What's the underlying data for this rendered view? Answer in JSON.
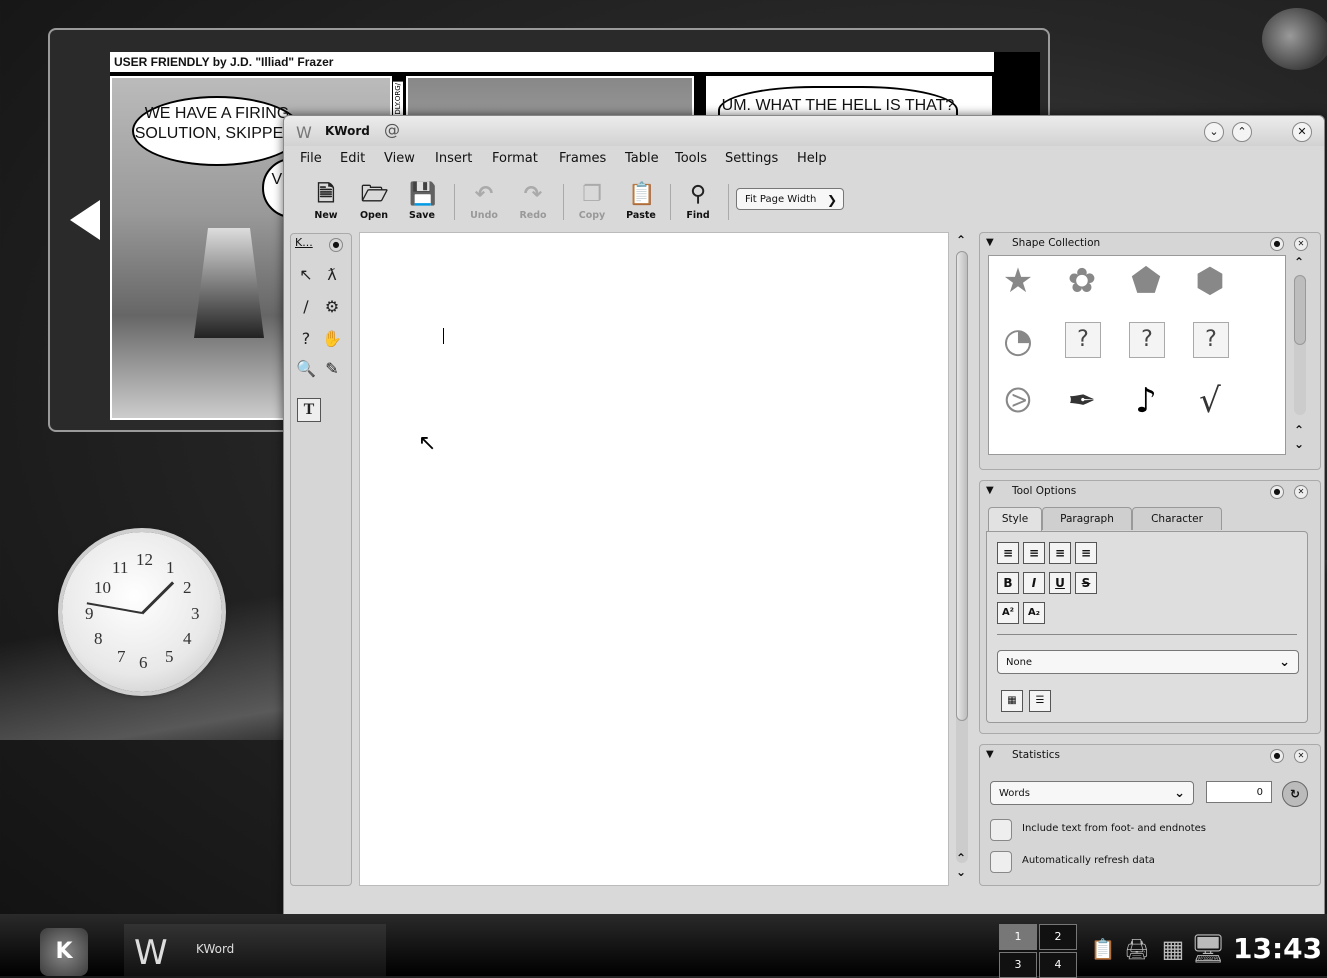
{
  "comic": {
    "title": "USER FRIENDLY by J.D. \"Illiad\" Frazer",
    "side_text": "DLY.ORG/",
    "panel1_bubble1": "WE HAVE A FIRING SOLUTION, SKIPPER.",
    "panel1_bubble2": "VE BI",
    "panel3_bubble": "UM. WHAT THE HELL IS THAT?"
  },
  "clock_widget": {
    "numbers": [
      "12",
      "1",
      "2",
      "3",
      "4",
      "5",
      "6",
      "7",
      "8",
      "9",
      "10",
      "11"
    ]
  },
  "window": {
    "title": "KWord",
    "menu": [
      "File",
      "Edit",
      "View",
      "Insert",
      "Format",
      "Frames",
      "Table",
      "Tools",
      "Settings",
      "Help"
    ],
    "toolbar": {
      "new": "New",
      "open": "Open",
      "save": "Save",
      "undo": "Undo",
      "redo": "Redo",
      "copy": "Copy",
      "paste": "Paste",
      "find": "Find",
      "zoom": "Fit Page Width"
    },
    "tooldock_title": "K..."
  },
  "dockers": {
    "shape_collection": {
      "title": "Shape Collection"
    },
    "tool_options": {
      "title": "Tool Options",
      "tabs": [
        "Style",
        "Paragraph",
        "Character"
      ],
      "style_select": "None"
    },
    "statistics": {
      "title": "Statistics",
      "type_select": "Words",
      "count": "0",
      "include_label": "Include text from foot- and endnotes",
      "refresh_label": "Automatically refresh data"
    }
  },
  "taskbar": {
    "task_label": "KWord",
    "pager": [
      "1",
      "2",
      "3",
      "4"
    ],
    "clock": "13:43"
  },
  "colors": {
    "desktop": "#262626",
    "window": "#d9d9d9",
    "taskbar": "#000000"
  }
}
